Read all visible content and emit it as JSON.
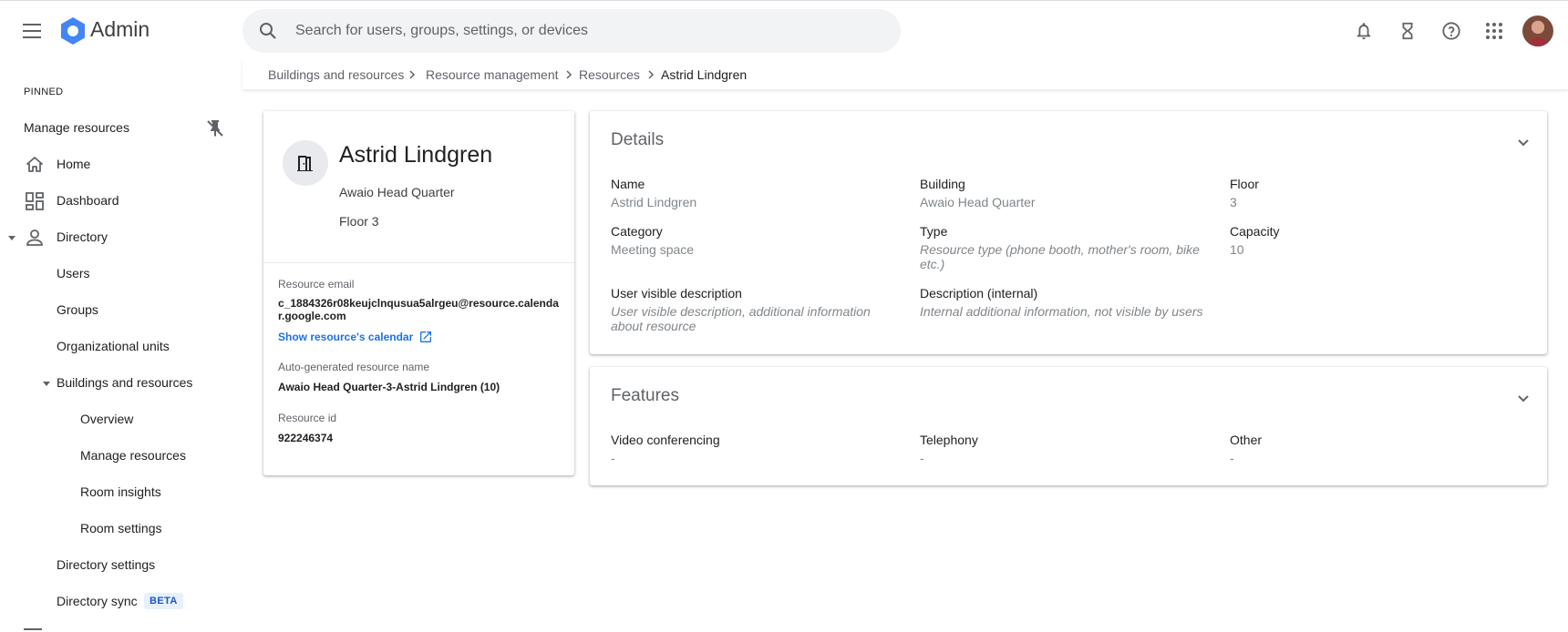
{
  "app": {
    "title": "Admin"
  },
  "search": {
    "placeholder": "Search for users, groups, settings, or devices"
  },
  "topbar_icons": [
    "notifications-icon",
    "hourglass-icon",
    "help-icon",
    "apps-grid-icon",
    "account-avatar"
  ],
  "breadcrumb": [
    "Buildings and resources",
    "Resource management",
    "Resources",
    "Astrid Lindgren"
  ],
  "sidebar": {
    "pinned_label": "PINNED",
    "pinned_items": [
      {
        "label": "Manage resources",
        "icon": "unpin-icon"
      }
    ],
    "items": [
      {
        "label": "Home",
        "icon": "home-icon"
      },
      {
        "label": "Dashboard",
        "icon": "dashboard-icon"
      },
      {
        "label": "Directory",
        "icon": "person-icon",
        "expanded": true
      },
      {
        "label": "Users"
      },
      {
        "label": "Groups"
      },
      {
        "label": "Organizational units"
      },
      {
        "label": "Buildings and resources",
        "expanded": true
      },
      {
        "label": "Overview"
      },
      {
        "label": "Manage resources"
      },
      {
        "label": "Room insights"
      },
      {
        "label": "Room settings"
      },
      {
        "label": "Directory settings"
      },
      {
        "label": "Directory sync",
        "badge": "BETA"
      }
    ]
  },
  "resource": {
    "name": "Astrid Lindgren",
    "building": "Awaio Head Quarter",
    "floor": "Floor 3",
    "email_label": "Resource email",
    "email": "c_1884326r08keujclnqusua5alrgeu@resource.calendar.google.com",
    "calendar_link": "Show resource's calendar",
    "autogen_label": "Auto-generated resource name",
    "autogen_name": "Awaio Head Quarter-3-Astrid Lindgren (10)",
    "id_label": "Resource id",
    "id": "922246374"
  },
  "details": {
    "title": "Details",
    "fields": {
      "name_label": "Name",
      "name_value": "Astrid Lindgren",
      "building_label": "Building",
      "building_value": "Awaio Head Quarter",
      "floor_label": "Floor",
      "floor_value": "3",
      "category_label": "Category",
      "category_value": "Meeting space",
      "type_label": "Type",
      "type_value": "Resource type (phone booth, mother's room, bike etc.)",
      "capacity_label": "Capacity",
      "capacity_value": "10",
      "uvd_label": "User visible description",
      "uvd_value": "User visible description, additional information about resource",
      "internal_label": "Description (internal)",
      "internal_value": "Internal additional information, not visible by users"
    }
  },
  "features": {
    "title": "Features",
    "video_label": "Video conferencing",
    "video_value": "-",
    "telephony_label": "Telephony",
    "telephony_value": "-",
    "other_label": "Other",
    "other_value": "-"
  },
  "colors": {
    "accent": "#1a73e8",
    "logo_blue": "#4285f4",
    "beta_bg": "#e8f0fe"
  }
}
